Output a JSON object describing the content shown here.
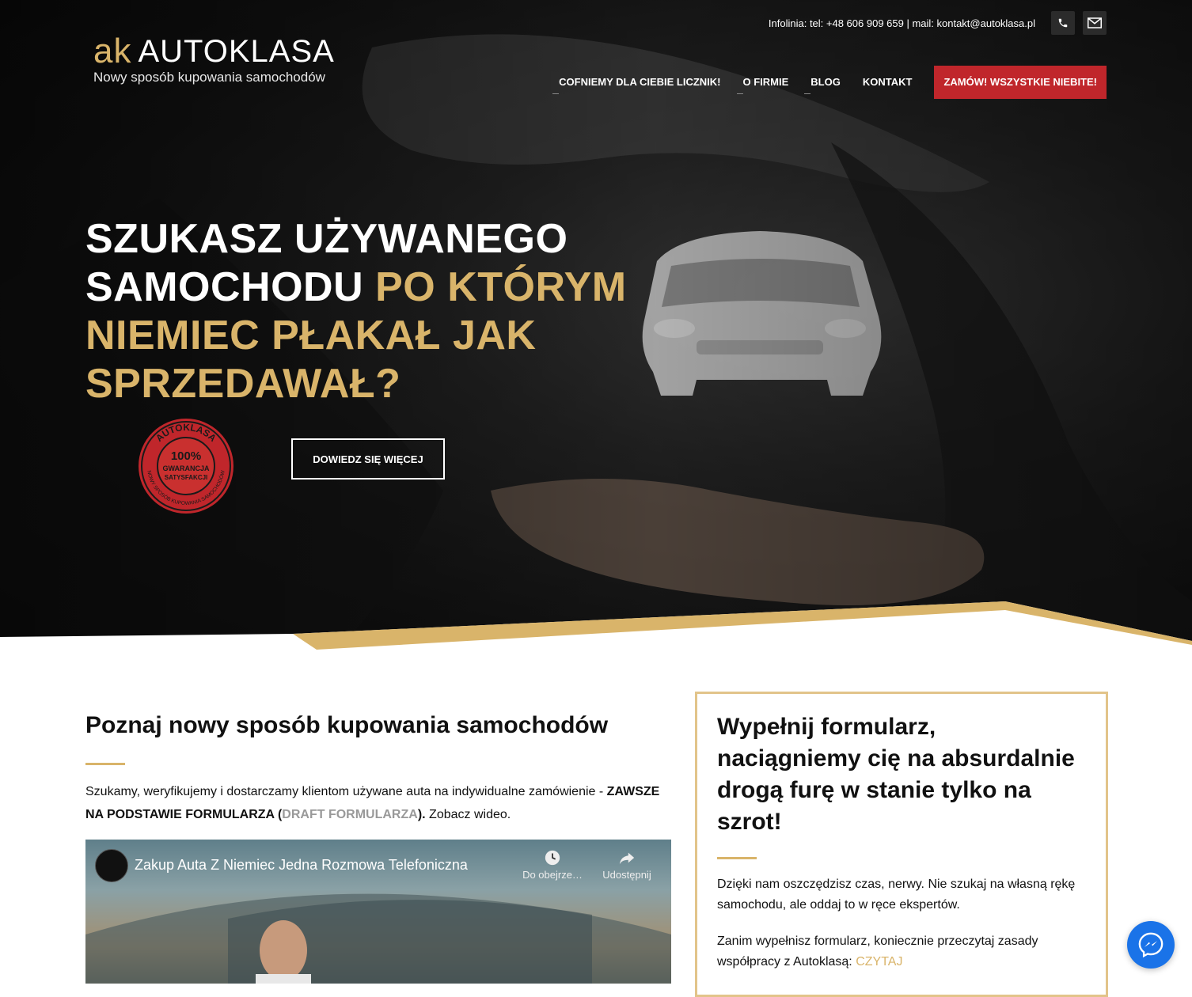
{
  "topbar": {
    "info": "Infolinia: tel: +48 606 909 659 | mail: kontakt@autoklasa.pl",
    "phone_icon": "phone-icon",
    "mail_icon": "mail-icon"
  },
  "logo": {
    "mark": "ak",
    "name": "AUTOKLASA",
    "tagline": "Nowy sposób kupowania samochodów"
  },
  "nav": {
    "items": [
      {
        "label": "COFNIEMY DLA CIEBIE LICZNIK!"
      },
      {
        "label": "O FIRMIE"
      },
      {
        "label": "BLOG"
      },
      {
        "label": "KONTAKT"
      }
    ],
    "cta": "ZAMÓW! WSZYSTKIE NIEBITE!"
  },
  "hero": {
    "headline_white": "SZUKASZ UŻYWANEGO SAMOCHODU ",
    "headline_gold": "PO KTÓRYM NIEMIEC PŁAKAŁ JAK SPRZEDAWAŁ?",
    "button": "DOWIEDZ SIĘ WIĘCEJ",
    "stamp": {
      "top": "AUTOKLASA",
      "percent": "100%",
      "line1": "GWARANCJA",
      "line2": "SATYSFAKCJI",
      "bottom": "NOWY SPOSÓB KUPOWANIA SAMOCHODÓW"
    }
  },
  "left": {
    "title": "Poznaj nowy sposób kupowania samochodów",
    "desc_start": "Szukamy, weryfikujemy i dostarczamy klientom używane auta na indywidualne zamówienie - ",
    "desc_bold": "ZAWSZE NA PODSTAWIE FORMULARZA (",
    "desc_link": "DRAFT FORMULARZA",
    "desc_bold_end": ").",
    "desc_end": " Zobacz wideo."
  },
  "video": {
    "title": "Zakup Auta Z Niemiec Jedna Rozmowa Telefoniczna",
    "watch_later": "Do obejrze…",
    "share": "Udostępnij"
  },
  "right": {
    "title": "Wypełnij formularz, naciągniemy cię na absurdalnie drogą furę w stanie tylko na szrot!",
    "p1": "Dzięki nam oszczędzisz czas, nerwy. Nie szukaj na własną rękę samochodu, ale oddaj to w ręce ekspertów.",
    "p2": "Zanim wypełnisz formularz, koniecznie przeczytaj zasady współpracy z Autoklasą: ",
    "link": "CZYTAJ"
  },
  "colors": {
    "gold": "#d9b46a",
    "red": "#c0262b",
    "messenger": "#1a73e8"
  }
}
